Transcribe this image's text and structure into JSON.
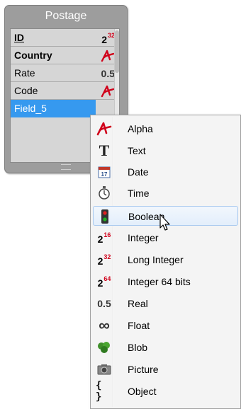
{
  "table": {
    "title": "Postage",
    "fields": [
      {
        "name": "ID",
        "type_icon": "long-integer-icon",
        "type_text": "2",
        "type_sup": "32",
        "style": "primary"
      },
      {
        "name": "Country",
        "type_icon": "alpha-icon",
        "style": "bold"
      },
      {
        "name": "Rate",
        "type_icon": "real-icon",
        "type_text": "0.5",
        "style": "normal"
      },
      {
        "name": "Code",
        "type_icon": "alpha-icon",
        "style": "normal"
      },
      {
        "name": "Field_5",
        "type_icon": "alpha-icon",
        "style": "selected"
      }
    ]
  },
  "menu": {
    "items": [
      {
        "label": "Alpha",
        "icon": "alpha-icon"
      },
      {
        "label": "Text",
        "icon": "text-icon"
      },
      {
        "label": "Date",
        "icon": "calendar-icon",
        "icon_text": "17"
      },
      {
        "label": "Time",
        "icon": "stopwatch-icon"
      },
      {
        "label": "Boolean",
        "icon": "traffic-light-icon"
      },
      {
        "label": "Integer",
        "icon": "integer-icon",
        "icon_text": "2",
        "icon_sup": "16"
      },
      {
        "label": "Long Integer",
        "icon": "long-integer-icon",
        "icon_text": "2",
        "icon_sup": "32"
      },
      {
        "label": "Integer 64 bits",
        "icon": "integer64-icon",
        "icon_text": "2",
        "icon_sup": "64"
      },
      {
        "label": "Real",
        "icon": "real-icon",
        "icon_text": "0.5"
      },
      {
        "label": "Float",
        "icon": "infinity-icon",
        "icon_text": "∞"
      },
      {
        "label": "Blob",
        "icon": "blob-icon"
      },
      {
        "label": "Picture",
        "icon": "camera-icon"
      },
      {
        "label": "Object",
        "icon": "braces-icon",
        "icon_text": "{ }"
      }
    ],
    "hovered": "Boolean"
  },
  "colors": {
    "panel": "#9d9d9d",
    "selected_row": "#3699ef",
    "alpha_red": "#d0021b",
    "menu_bg": "#f4f4f4"
  }
}
